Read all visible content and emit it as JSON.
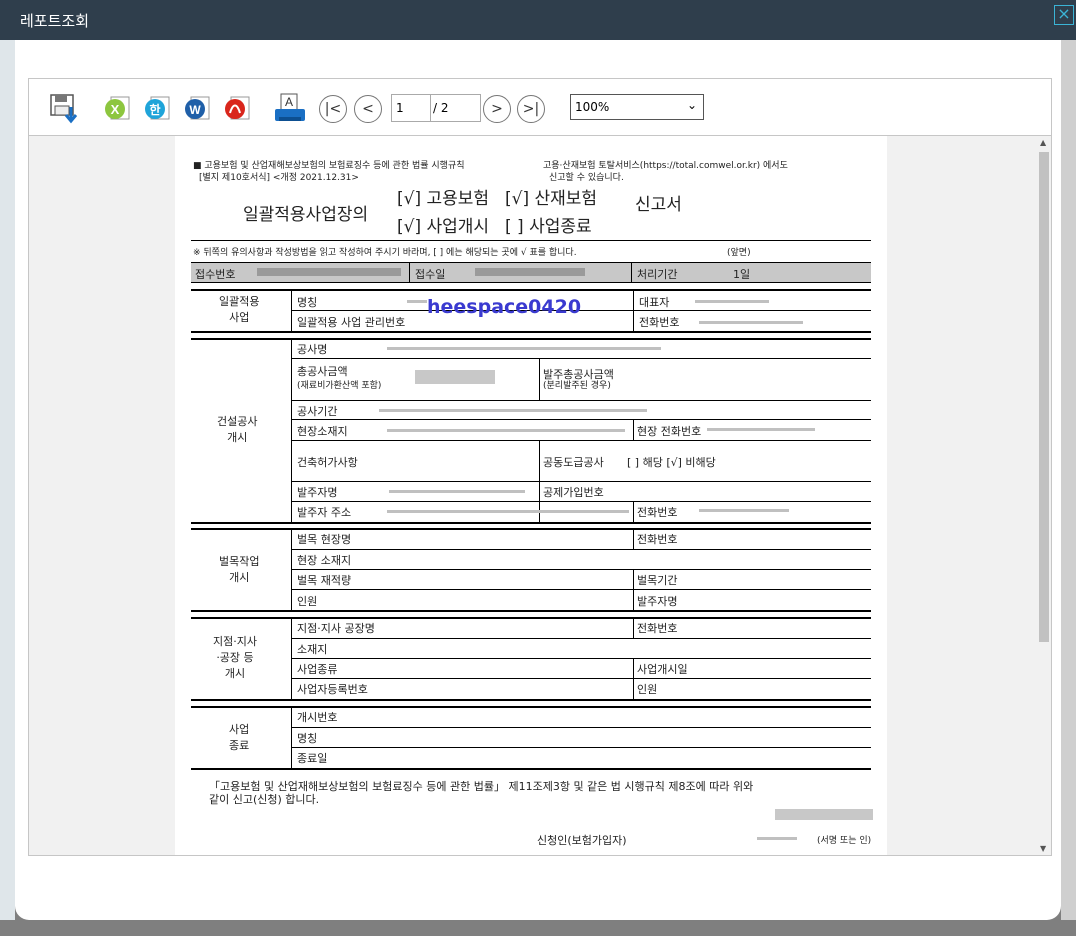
{
  "window": {
    "title": "레포트조회",
    "close_label": "×"
  },
  "toolbar": {
    "icons": [
      "save-icon",
      "excel-icon",
      "hwp-icon",
      "word-icon",
      "pdf-icon",
      "print-icon"
    ],
    "page_current": "1",
    "page_total": "/ 2",
    "zoom": "100%",
    "nav": {
      "first": "|<",
      "prev": "<",
      "next": ">",
      "last": ">|"
    }
  },
  "document": {
    "header_left_1": "■ 고용보험 및 산업재해보상보험의 보험료징수 등에 관한 법률 시행규칙",
    "header_left_2": "[별지 제10호서식] <개정 2021.12.31>",
    "header_right_1": "고용·산재보험 토탈서비스(https://total.comwel.or.kr) 에서도",
    "header_right_2": "신고할 수 있습니다.",
    "title_main": "일괄적용사업장의",
    "title_opt1": "[√] 고용보험",
    "title_opt2": "[√] 산재보험",
    "title_opt3": "[√] 사업개시",
    "title_opt4": "[  ] 사업종료",
    "title_end": "신고서",
    "notice": "※ 뒤쪽의 유의사항과 작성방법을 읽고 작성하여 주시기 바라며, [ ] 에는 해당되는 곳에 √ 표를 합니다.",
    "notice_right": "(앞면)",
    "receipt_no": "접수번호",
    "receipt_date": "접수일",
    "process_period": "처리기간",
    "process_value": "1일",
    "sec1_title": "일괄적용\n사업",
    "sec1_name": "명칭",
    "sec1_rep": "대표자",
    "sec1_mgmt": "일괄적용 사업 관리번호",
    "sec1_phone": "전화번호",
    "watermark": "heespace0420",
    "sec2_title": "건설공사\n개시",
    "sec2_project": "공사명",
    "sec2_total": "총공사금액",
    "sec2_total_sub": "(재료비가환산액 포함)",
    "sec2_order": "발주총공사금액",
    "sec2_order_sub": "(분리발주된 경우)",
    "sec2_period": "공사기간",
    "sec2_site": "현장소재지",
    "sec2_site_phone": "현장 전화번호",
    "sec2_permit": "건축허가사항",
    "sec2_joint": "공동도급공사",
    "sec2_joint_value": "[   ] 해당 [√] 비해당",
    "sec2_orderer": "발주자명",
    "sec2_deduct": "공제가입번호",
    "sec2_orderer_addr": "발주자 주소",
    "sec2_phone": "전화번호",
    "sec3_title": "벌목작업\n개시",
    "sec3_site": "벌목 현장명",
    "sec3_phone": "전화번호",
    "sec3_location": "현장 소재지",
    "sec3_amount": "벌목 재적량",
    "sec3_period": "벌목기간",
    "sec3_people": "인원",
    "sec3_orderer": "발주자명",
    "sec4_title": "지점·지사\n·공장 등\n개시",
    "sec4_name": "지점·지사 공장명",
    "sec4_phone": "전화번호",
    "sec4_location": "소재지",
    "sec4_type": "사업종류",
    "sec4_start": "사업개시일",
    "sec4_regno": "사업자등록번호",
    "sec4_people": "인원",
    "sec5_title": "사업\n종료",
    "sec5_no": "개시번호",
    "sec5_name": "명칭",
    "sec5_end": "종료일",
    "footer_1": "「고용보험 및 산업재해보상보험의 보험료징수 등에 관한 법률」 제11조제3항 및 같은 법 시행규칙 제8조에 따라 위와",
    "footer_2": "같이 신고(신청) 합니다.",
    "applicant": "신청인(보험가입자)",
    "sign": "(서명 또는 인)"
  }
}
